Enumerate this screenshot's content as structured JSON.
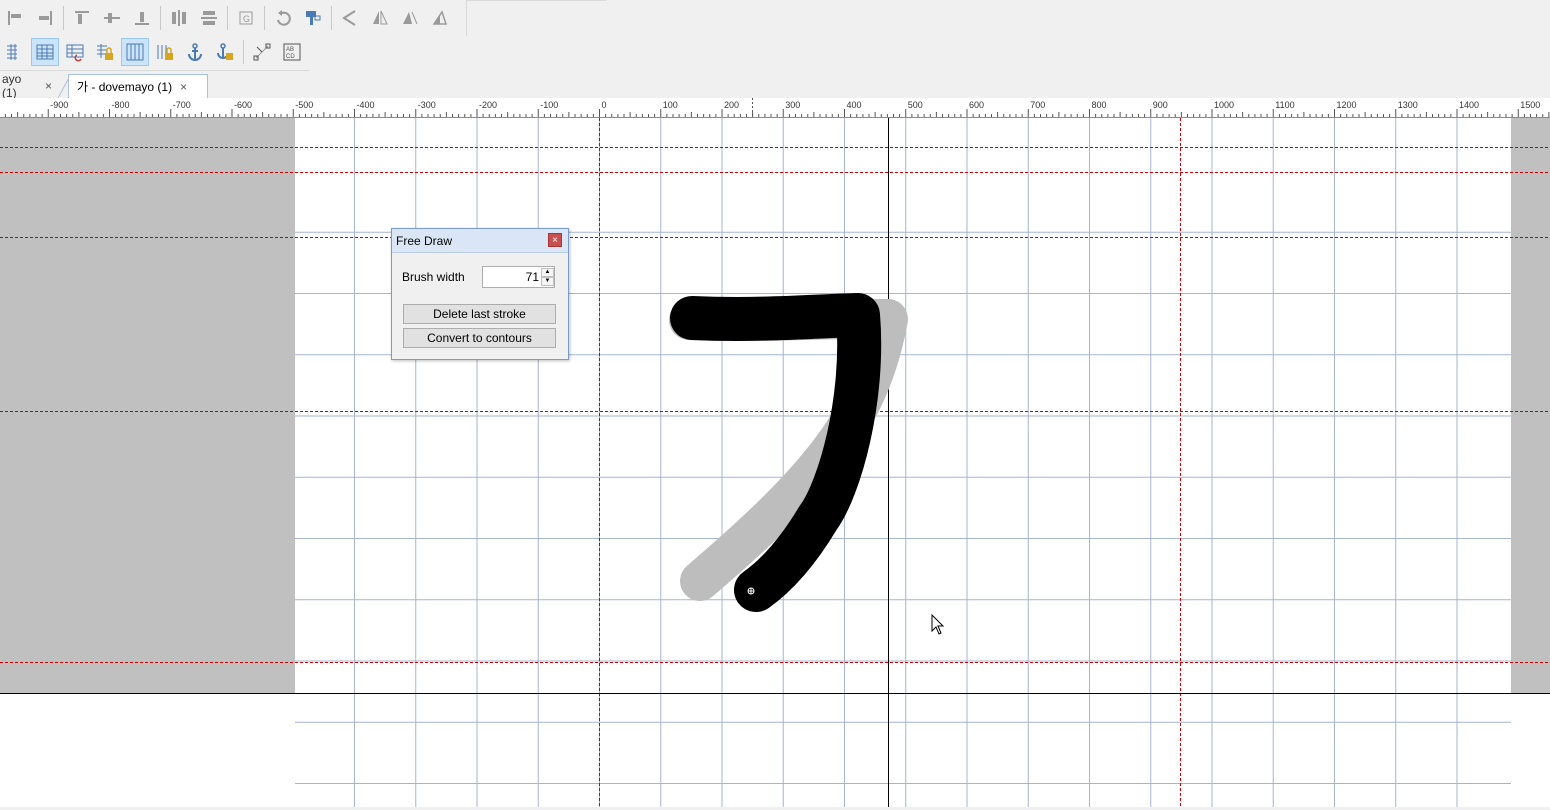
{
  "toolbar": {
    "row1": [
      {
        "name": "align-left-icon",
        "active": false
      },
      {
        "name": "align-right-icon",
        "active": false
      },
      {
        "sep": true
      },
      {
        "name": "align-top-icon",
        "active": false
      },
      {
        "name": "align-middle-icon",
        "active": false
      },
      {
        "name": "align-bottom-icon",
        "active": false
      },
      {
        "sep": true
      },
      {
        "name": "distribute-horizontal-icon",
        "active": false
      },
      {
        "name": "distribute-vertical-icon",
        "active": false
      },
      {
        "sep": true
      },
      {
        "name": "guideline-icon",
        "active": false
      },
      {
        "sep": true
      },
      {
        "name": "rotate-icon",
        "active": false
      },
      {
        "name": "paste-transform-icon",
        "active": false
      },
      {
        "sep": true
      },
      {
        "name": "flip-left-icon",
        "active": false
      },
      {
        "name": "flip-horizontal-icon",
        "active": false
      },
      {
        "name": "skew-left-icon",
        "active": false
      },
      {
        "name": "skew-right-icon",
        "active": false
      }
    ],
    "row2": [
      {
        "name": "grid-partial-icon",
        "active": false
      },
      {
        "name": "grid-icon",
        "active": true
      },
      {
        "name": "grid-snap-icon",
        "active": false
      },
      {
        "name": "grid-lock-icon",
        "active": false
      },
      {
        "name": "columns-grid-icon",
        "active": true
      },
      {
        "name": "columns-lock-icon",
        "active": false
      },
      {
        "name": "anchor-icon",
        "active": false
      },
      {
        "name": "anchor-lock-icon",
        "active": false
      },
      {
        "sep": true
      },
      {
        "name": "node-icon",
        "active": false
      },
      {
        "name": "glyph-cell-icon",
        "active": false
      }
    ]
  },
  "tabs": [
    {
      "label": "ayo (1)",
      "close": "×",
      "active": false
    },
    {
      "label": "가 - dovemayo (1)",
      "close": "×",
      "active": true
    }
  ],
  "ruler": {
    "labels": [
      "-900",
      "-800",
      "-700",
      "-600",
      "-500",
      "-400",
      "-300",
      "-200",
      "-100",
      "0",
      "100",
      "200",
      "300",
      "400",
      "500",
      "600",
      "700",
      "800",
      "900",
      "1000",
      "1100",
      "1200",
      "1300",
      "1400",
      "1500"
    ]
  },
  "dialog": {
    "title": "Free Draw",
    "close": "×",
    "brush_width_label": "Brush width",
    "brush_width_value": "71",
    "delete_button": "Delete last stroke",
    "convert_button": "Convert to contours"
  },
  "colors": {
    "guide_red": "#cc0000",
    "grid_blue": "#a6b4d2",
    "outside_gray": "#c0c0c0",
    "stroke_black": "#000000",
    "stroke_shadow": "#bdbdbd"
  }
}
